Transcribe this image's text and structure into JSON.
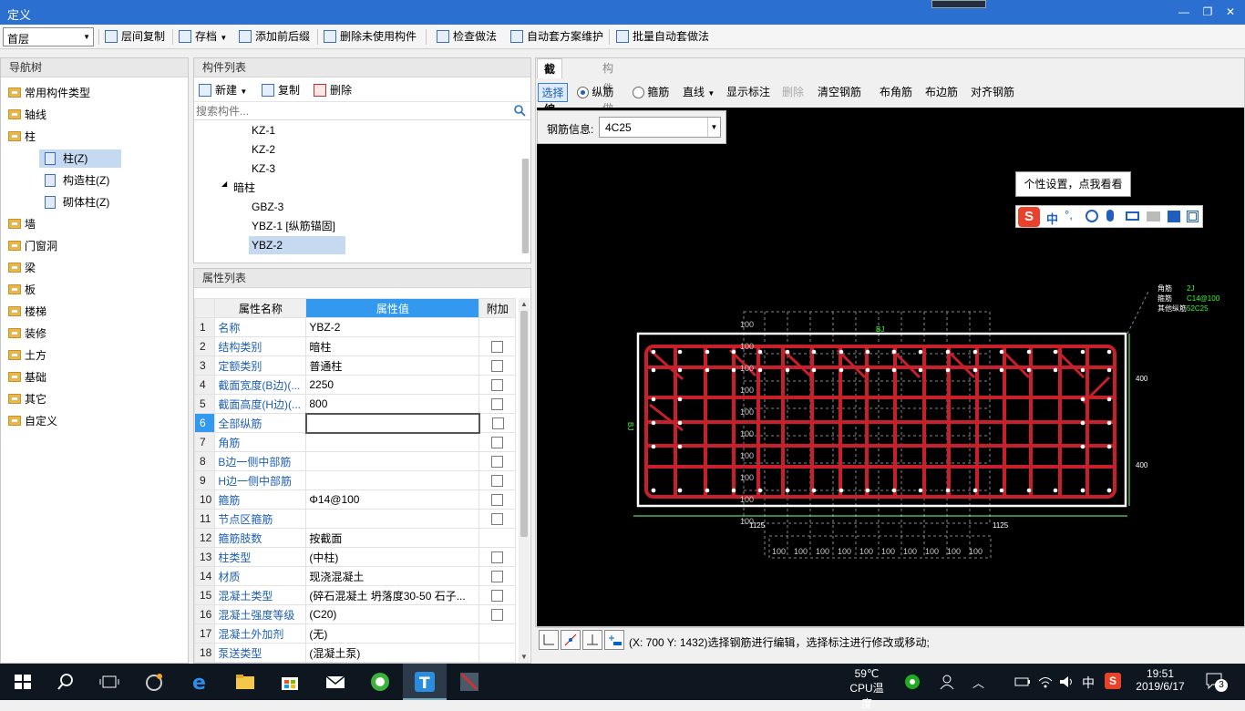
{
  "window": {
    "title": "定义"
  },
  "toolbar": {
    "floor_value": "首层",
    "buttons": [
      {
        "label": "层间复制",
        "icon": "copy-floor-icon"
      },
      {
        "label": "存档",
        "icon": "save-icon"
      },
      {
        "label": "添加前后缀",
        "icon": "prefix-icon"
      },
      {
        "label": "删除未使用构件",
        "icon": "delete-unused-icon"
      },
      {
        "label": "检查做法",
        "icon": "check-icon"
      },
      {
        "label": "自动套方案维护",
        "icon": "auto-scheme-icon"
      },
      {
        "label": "批量自动套做法",
        "icon": "batch-icon"
      }
    ]
  },
  "nav": {
    "title": "导航树",
    "items": [
      {
        "label": "常用构件类型"
      },
      {
        "label": "轴线"
      },
      {
        "label": "柱"
      },
      {
        "label": "柱(Z)"
      },
      {
        "label": "构造柱(Z)"
      },
      {
        "label": "砌体柱(Z)"
      },
      {
        "label": "墙"
      },
      {
        "label": "门窗洞"
      },
      {
        "label": "梁"
      },
      {
        "label": "板"
      },
      {
        "label": "楼梯"
      },
      {
        "label": "装修"
      },
      {
        "label": "土方"
      },
      {
        "label": "基础"
      },
      {
        "label": "其它"
      },
      {
        "label": "自定义"
      }
    ]
  },
  "components": {
    "title": "构件列表",
    "new_label": "新建",
    "copy_label": "复制",
    "delete_label": "删除",
    "search_placeholder": "搜索构件...",
    "items": [
      "KZ-1",
      "KZ-2",
      "KZ-3",
      "暗柱",
      "GBZ-3",
      "YBZ-1 [纵筋锚固]",
      "YBZ-2"
    ]
  },
  "properties": {
    "title": "属性列表",
    "col_name": "属性名称",
    "col_value": "属性值",
    "col_add": "附加",
    "rows": [
      {
        "no": "1",
        "name": "名称",
        "value": "YBZ-2"
      },
      {
        "no": "2",
        "name": "结构类别",
        "value": "暗柱"
      },
      {
        "no": "3",
        "name": "定额类别",
        "value": "普通柱"
      },
      {
        "no": "4",
        "name": "截面宽度(B边)(...",
        "value": "2250"
      },
      {
        "no": "5",
        "name": "截面高度(H边)(...",
        "value": "800"
      },
      {
        "no": "6",
        "name": "全部纵筋",
        "value": ""
      },
      {
        "no": "7",
        "name": "角筋",
        "value": ""
      },
      {
        "no": "8",
        "name": "B边一侧中部筋",
        "value": ""
      },
      {
        "no": "9",
        "name": "H边一侧中部筋",
        "value": ""
      },
      {
        "no": "10",
        "name": "箍筋",
        "value": "Φ14@100"
      },
      {
        "no": "11",
        "name": "节点区箍筋",
        "value": ""
      },
      {
        "no": "12",
        "name": "箍筋肢数",
        "value": "按截面"
      },
      {
        "no": "13",
        "name": "柱类型",
        "value": "(中柱)"
      },
      {
        "no": "14",
        "name": "材质",
        "value": "现浇混凝土"
      },
      {
        "no": "15",
        "name": "混凝土类型",
        "value": "(碎石混凝土 坍落度30-50 石子..."
      },
      {
        "no": "16",
        "name": "混凝土强度等级",
        "value": "(C20)"
      },
      {
        "no": "17",
        "name": "混凝土外加剂",
        "value": "(无)"
      },
      {
        "no": "18",
        "name": "泵送类型",
        "value": "(混凝土泵)"
      }
    ]
  },
  "editor": {
    "tab_section": "截面编辑",
    "tab_method": "构件做法",
    "select_label": "选择",
    "long_bar_label": "纵筋",
    "stirrup_label": "箍筋",
    "line_label": "直线",
    "show_mark_label": "显示标注",
    "delete_label": "删除",
    "clear_label": "清空钢筋",
    "corner_label": "布角筋",
    "edge_label": "布边筋",
    "align_label": "对齐钢筋",
    "rebar_info_label": "钢筋信息:",
    "rebar_info_value": "4C25"
  },
  "drawing": {
    "legend": [
      {
        "key": "角筋",
        "val": "2J"
      },
      {
        "key": "箍筋",
        "val": "C14@100"
      },
      {
        "key": "其他纵筋",
        "val": "52C25"
      }
    ],
    "bj_label": "BJ",
    "dim_h1": "400",
    "dim_h2": "400",
    "dim_b1": "1125",
    "dim_b2": "1125",
    "left_dims": [
      "100",
      "100",
      "100",
      "100",
      "100",
      "100",
      "100",
      "100",
      "100",
      "100"
    ],
    "bottom_dims": [
      "100",
      "100",
      "100",
      "100",
      "100",
      "100",
      "100",
      "100",
      "100",
      "100"
    ]
  },
  "ime": {
    "tip": "个性设置，点我看看",
    "mode": "中"
  },
  "status": {
    "text": "(X: 700 Y: 1432)选择钢筋进行编辑，选择标注进行修改或移动;"
  },
  "taskbar": {
    "temp": "59℃",
    "temp_label": "CPU温度",
    "ime": "中",
    "time": "19:51",
    "date": "2019/6/17",
    "notif": "3"
  }
}
